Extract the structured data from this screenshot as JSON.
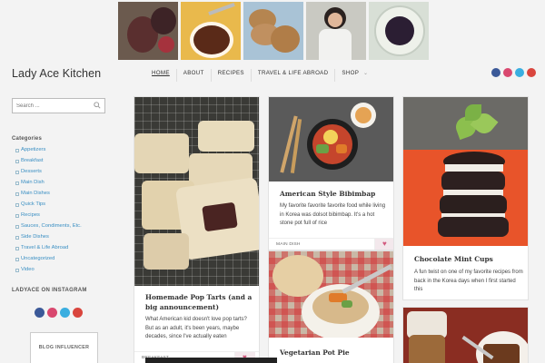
{
  "site": {
    "title": "Lady Ace Kitchen"
  },
  "photo_strip": [
    {
      "name": "figs-photo"
    },
    {
      "name": "sauce-bowl-photo"
    },
    {
      "name": "cookies-photo"
    },
    {
      "name": "author-photo"
    },
    {
      "name": "berries-bowl-photo"
    }
  ],
  "nav": {
    "items": [
      {
        "label": "HOME",
        "active": true
      },
      {
        "label": "ABOUT"
      },
      {
        "label": "RECIPES"
      },
      {
        "label": "TRAVEL & LIFE ABROAD"
      },
      {
        "label": "SHOP",
        "has_dropdown": true
      }
    ],
    "dropdown_glyph": "⌄"
  },
  "social_icons": [
    "facebook-icon",
    "instagram-icon",
    "twitter-icon",
    "youtube-icon"
  ],
  "sidebar": {
    "search": {
      "placeholder": "Search ..."
    },
    "categories_heading": "Categories",
    "categories": [
      "Appetizers",
      "Breakfast",
      "Desserts",
      "Main Dish",
      "Main Dishes",
      "Quick Tips",
      "Recipes",
      "Sauces, Condiments, Etc.",
      "Side Dishes",
      "Travel & Life Abroad",
      "Uncategorized",
      "Video"
    ],
    "instagram_heading": "LADYACE ON INSTAGRAM",
    "badge_text": "BLOG INFLUENCER"
  },
  "posts": [
    {
      "title": "Homemade Pop Tarts (and a big announcement)",
      "excerpt": "What American kid doesn't love pop tarts? But as an adult, it's been years, maybe decades, since I've actually eaten",
      "category": "BREAKFAST"
    },
    {
      "title": "American Style Bibimbap",
      "excerpt": "My favorite favorite favorite food while living in Korea was dolsot bibimbap. It's a hot stone pot full of rice",
      "category": "MAIN DISH"
    },
    {
      "title": "Vegetarian Pot Pie",
      "excerpt": "",
      "category": ""
    },
    {
      "title": "Chocolate Mint Cups",
      "excerpt": "A fun twist on one of my favorite recipes from back in the Korea days when I first started this",
      "category": ""
    },
    {
      "title": "",
      "excerpt": "",
      "category": ""
    }
  ],
  "colors": {
    "link": "#3a8fc3",
    "heart": "#d25a7f",
    "facebook": "#3b5998",
    "instagram": "#d9486f",
    "twitter": "#3aaee0",
    "youtube": "#d9453d",
    "mint_cups_background": "#e8542a"
  },
  "icons": {
    "heart": "♥",
    "search": "search-icon"
  }
}
